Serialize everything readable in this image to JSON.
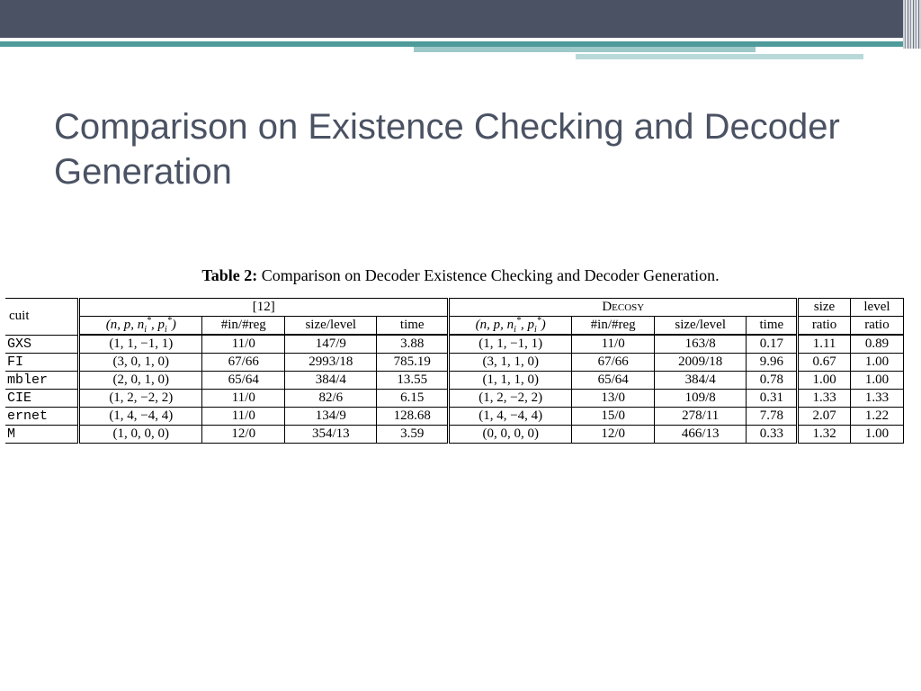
{
  "slide_title": "Comparison on  Existence Checking and Decoder Generation",
  "table": {
    "caption_bold": "Table 2:",
    "caption_rest": " Comparison on Decoder Existence Checking and Decoder Generation.",
    "headers": {
      "circuit": "cuit",
      "group12": "[12]",
      "decosy": "Decosy",
      "params": "(n, p, nᵢ*, pᵢ*)",
      "params2": "(n, p, nᵢ*, pᵢ*)",
      "inreg": "#in/#reg",
      "sizelevel": "size/level",
      "time": "time",
      "sizeratio_a": "size",
      "sizeratio_b": "ratio",
      "levelratio_a": "level",
      "levelratio_b": "ratio"
    },
    "rows": [
      {
        "name": "GXS",
        "a": "(1, 1, −1, 1)",
        "b": "11/0",
        "c": "147/9",
        "d": "3.88",
        "e": "(1, 1, −1, 1)",
        "f": "11/0",
        "g": "163/8",
        "h": "0.17",
        "i": "1.11",
        "j": "0.89"
      },
      {
        "name": "FI",
        "a": "(3, 0, 1, 0)",
        "b": "67/66",
        "c": "2993/18",
        "d": "785.19",
        "e": "(3, 1, 1, 0)",
        "f": "67/66",
        "g": "2009/18",
        "h": "9.96",
        "i": "0.67",
        "j": "1.00"
      },
      {
        "name": "mbler",
        "a": "(2, 0, 1, 0)",
        "b": "65/64",
        "c": "384/4",
        "d": "13.55",
        "e": "(1, 1, 1, 0)",
        "f": "65/64",
        "g": "384/4",
        "h": "0.78",
        "i": "1.00",
        "j": "1.00"
      },
      {
        "name": "CIE",
        "a": "(1, 2, −2, 2)",
        "b": "11/0",
        "c": "82/6",
        "d": "6.15",
        "e": "(1, 2, −2, 2)",
        "f": "13/0",
        "g": "109/8",
        "h": "0.31",
        "i": "1.33",
        "j": "1.33"
      },
      {
        "name": "ernet",
        "a": "(1, 4, −4, 4)",
        "b": "11/0",
        "c": "134/9",
        "d": "128.68",
        "e": "(1, 4, −4, 4)",
        "f": "15/0",
        "g": "278/11",
        "h": "7.78",
        "i": "2.07",
        "j": "1.22"
      },
      {
        "name": "M",
        "a": "(1, 0, 0, 0)",
        "b": "12/0",
        "c": "354/13",
        "d": "3.59",
        "e": "(0, 0, 0, 0)",
        "f": "12/0",
        "g": "466/13",
        "h": "0.33",
        "i": "1.32",
        "j": "1.00"
      }
    ]
  },
  "chart_data": {
    "type": "table",
    "title": "Table 2: Comparison on Decoder Existence Checking and Decoder Generation.",
    "columns": [
      "circuit",
      "[12] (n,p,n_i*,p_i*)",
      "[12] #in/#reg",
      "[12] size/level",
      "[12] time",
      "Decosy (n,p,n_i*,p_i*)",
      "Decosy #in/#reg",
      "Decosy size/level",
      "Decosy time",
      "size ratio",
      "level ratio"
    ],
    "rows": [
      [
        "GXS",
        "(1,1,-1,1)",
        "11/0",
        "147/9",
        3.88,
        "(1,1,-1,1)",
        "11/0",
        "163/8",
        0.17,
        1.11,
        0.89
      ],
      [
        "FI",
        "(3,0,1,0)",
        "67/66",
        "2993/18",
        785.19,
        "(3,1,1,0)",
        "67/66",
        "2009/18",
        9.96,
        0.67,
        1.0
      ],
      [
        "mbler",
        "(2,0,1,0)",
        "65/64",
        "384/4",
        13.55,
        "(1,1,1,0)",
        "65/64",
        "384/4",
        0.78,
        1.0,
        1.0
      ],
      [
        "CIE",
        "(1,2,-2,2)",
        "11/0",
        "82/6",
        6.15,
        "(1,2,-2,2)",
        "13/0",
        "109/8",
        0.31,
        1.33,
        1.33
      ],
      [
        "ernet",
        "(1,4,-4,4)",
        "11/0",
        "134/9",
        128.68,
        "(1,4,-4,4)",
        "15/0",
        "278/11",
        7.78,
        2.07,
        1.22
      ],
      [
        "M",
        "(1,0,0,0)",
        "12/0",
        "354/13",
        3.59,
        "(0,0,0,0)",
        "12/0",
        "466/13",
        0.33,
        1.32,
        1.0
      ]
    ]
  }
}
